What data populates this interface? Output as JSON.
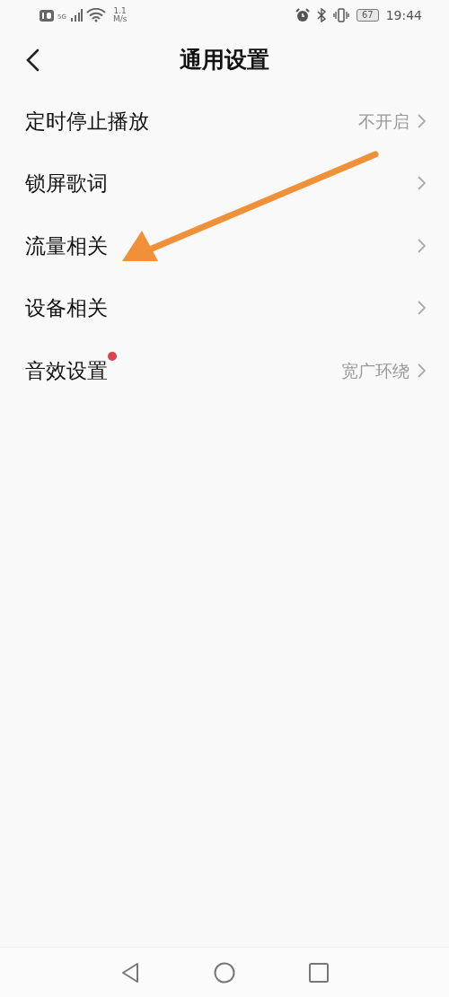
{
  "status_bar": {
    "speed_value": "1.1",
    "speed_unit": "M/s",
    "network": "5G",
    "battery": "67",
    "time": "19:44"
  },
  "header": {
    "title": "通用设置"
  },
  "settings": [
    {
      "label": "定时停止播放",
      "value": "不开启",
      "new": false
    },
    {
      "label": "锁屏歌词",
      "new": false
    },
    {
      "label": "流量相关",
      "new": false
    },
    {
      "label": "设备相关",
      "new": false
    },
    {
      "label": "音效设置",
      "value": "宽广环绕",
      "new": true
    }
  ]
}
